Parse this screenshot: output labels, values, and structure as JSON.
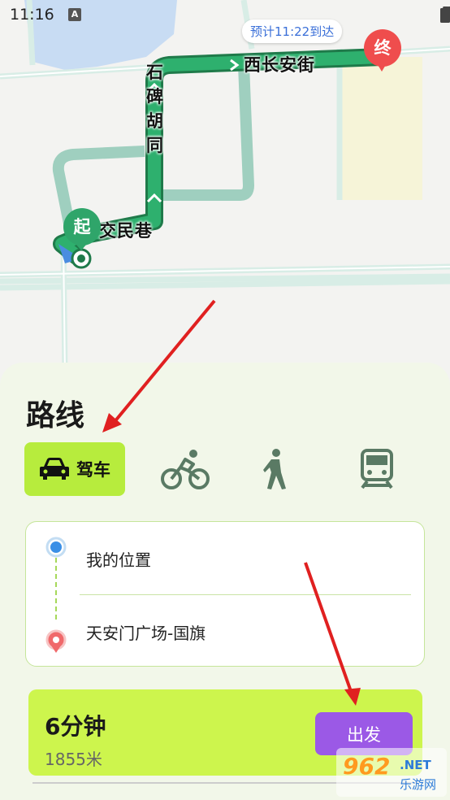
{
  "status_bar": {
    "time": "11:16",
    "a_icon_text": "A"
  },
  "map": {
    "eta_label": "预计11:22到达",
    "start_pin": "起",
    "end_pin": "终",
    "roads": {
      "west_changan": "西长安街",
      "shibei": "石碑胡同",
      "jiaomin": "交民巷"
    }
  },
  "panel": {
    "title": "路线",
    "modes": [
      {
        "label": "驾车",
        "icon": "car-icon",
        "active": true
      },
      {
        "label": "",
        "icon": "bicycle-icon",
        "active": false
      },
      {
        "label": "",
        "icon": "walk-icon",
        "active": false
      },
      {
        "label": "",
        "icon": "train-icon",
        "active": false
      }
    ],
    "origin": "我的位置",
    "destination": "天安门广场-国旗",
    "route": {
      "duration": "6分钟",
      "distance": "1855米",
      "go_label": "出发"
    }
  },
  "watermark": {
    "num": "962",
    "net": ".NET",
    "site": "乐游网"
  },
  "colors": {
    "accent_green": "#b7ec3d",
    "route_card": "#cdf54d",
    "go_button": "#9b59e6",
    "route_line": "#1f9a5c",
    "alt_route": "#9fcfbf",
    "end_pin": "#ef4d4d",
    "start_pin": "#2fa56a",
    "arrow_red": "#e02020"
  }
}
